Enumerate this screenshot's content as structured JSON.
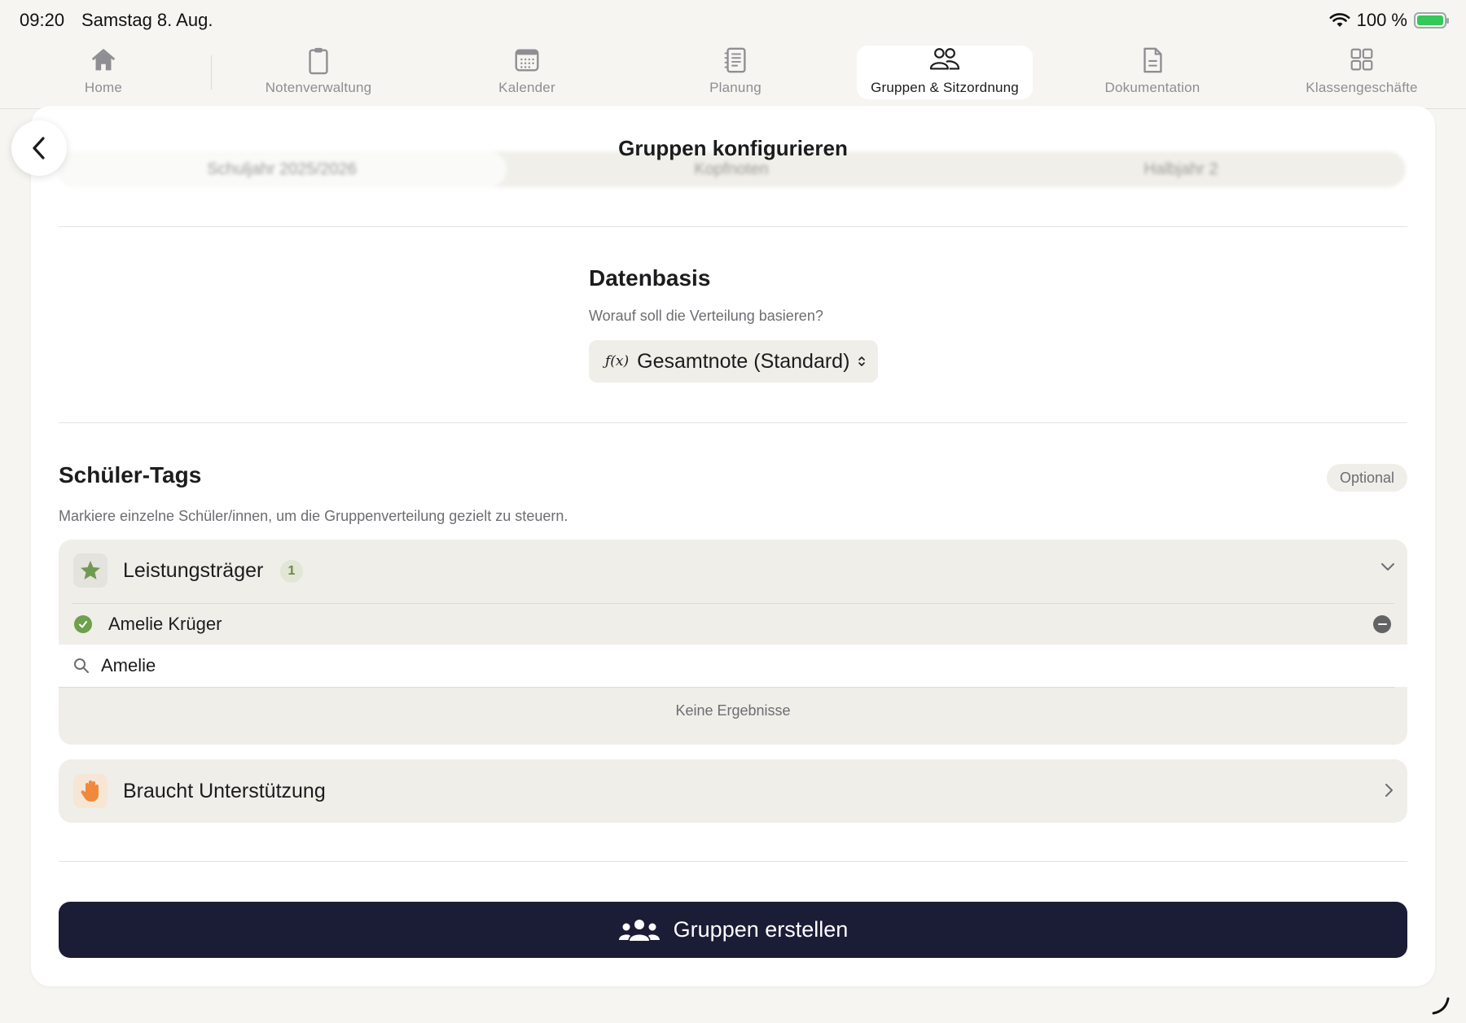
{
  "status_bar": {
    "time": "09:20",
    "date": "Samstag 8. Aug.",
    "battery": "100 %"
  },
  "tabs": [
    {
      "label": "Home",
      "icon": "house-icon"
    },
    {
      "label": "Notenverwaltung",
      "icon": "clipboard-icon"
    },
    {
      "label": "Kalender",
      "icon": "calendar-icon"
    },
    {
      "label": "Planung",
      "icon": "notebook-icon"
    },
    {
      "label": "Gruppen & Sitzordnung",
      "icon": "people-icon",
      "active": true
    },
    {
      "label": "Dokumentation",
      "icon": "document-icon"
    },
    {
      "label": "Klassengeschäfte",
      "icon": "grid-icon"
    }
  ],
  "background": {
    "segments": [
      "Schuljahr 2025/2026",
      "Kopfnoten",
      "Halbjahr 2"
    ]
  },
  "page": {
    "title": "Gruppen konfigurieren"
  },
  "datenbasis": {
    "title": "Datenbasis",
    "subtitle": "Worauf soll die Verteilung basieren?",
    "fx": "ƒ(x)",
    "selected": "Gesamtnote (Standard)"
  },
  "tags_section": {
    "title": "Schüler-Tags",
    "badge": "Optional",
    "subtitle": "Markiere einzelne Schüler/innen, um die Gruppenverteilung gezielt zu steuern."
  },
  "tags": [
    {
      "name": "Leistungsträger",
      "count": "1",
      "icon": "star-icon",
      "expanded": true,
      "members": [
        "Amelie Krüger"
      ],
      "search_value": "Amelie",
      "empty_text": "Keine Ergebnisse"
    },
    {
      "name": "Braucht Unterstützung",
      "icon": "hand-icon",
      "expanded": false
    }
  ],
  "create_button": {
    "label": "Gruppen erstellen",
    "icon": "group-icon"
  },
  "colors": {
    "accent": "#1b1c36",
    "tag_green": "#6ea04e",
    "tag_orange": "#ef8a3c",
    "background": "#f6f5f1"
  }
}
